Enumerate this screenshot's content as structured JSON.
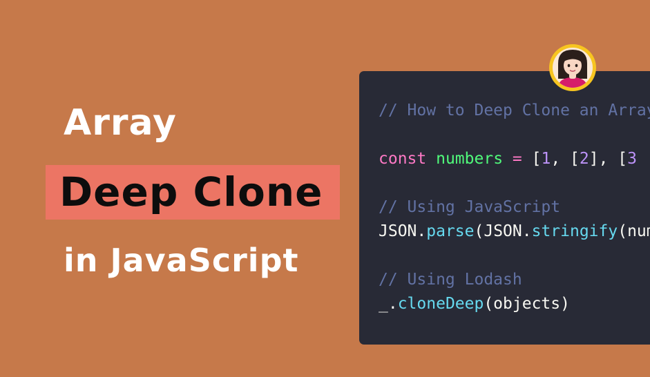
{
  "title": {
    "line1": "Array",
    "line2": "Deep Clone",
    "line3": "in JavaScript"
  },
  "code": {
    "comment1": "// How to Deep Clone an Array",
    "const_kw": "const",
    "var_name": "numbers",
    "eq": "=",
    "arr_open": "[",
    "n1": "1",
    "sep1": ", [",
    "n2": "2",
    "sep2": "], [",
    "n3": "3",
    "comment2": "// Using JavaScript",
    "json1": "JSON.",
    "parse": "parse",
    "json2": "(JSON.",
    "stringify": "stringify",
    "stringify_tail": "(numbers))",
    "comment3": "// Using Lodash",
    "lodash": "_.",
    "clone_deep": "cloneDeep",
    "clone_args": "(objects)"
  },
  "colors": {
    "background": "#C6794A",
    "highlight": "#EC7564",
    "code_bg": "#282A36",
    "comment": "#6272A4",
    "keyword": "#FF79C6",
    "variable": "#50FA7B",
    "number": "#BD93F9",
    "function": "#66D9EF",
    "avatar_ring": "#F7C520"
  },
  "icons": {
    "avatar": "girl-avatar-icon"
  }
}
